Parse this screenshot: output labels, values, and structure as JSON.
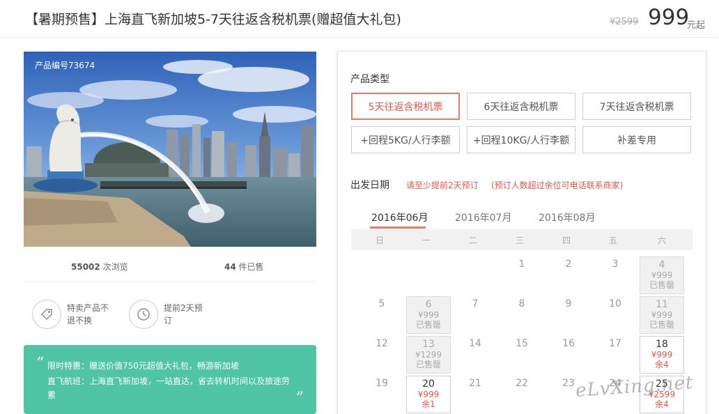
{
  "header": {
    "title": "【暑期预售】上海直飞新加坡5-7天往返含税机票(赠超值大礼包)",
    "original_price": "¥2599",
    "price": "999",
    "price_unit": "元起"
  },
  "photo": {
    "product_code": "产品编号73674"
  },
  "stats": {
    "views_count": "55002",
    "views_label": " 次浏览",
    "sold_count": "44",
    "sold_label": " 件已售"
  },
  "features": [
    {
      "icon": "tag-icon",
      "text": "特卖产品不退不换"
    },
    {
      "icon": "clock-icon",
      "text": "提前2天预订"
    }
  ],
  "promo": {
    "open_quote": "“",
    "close_quote": "”",
    "line1": "限时特惠：赠送价值750元超值大礼包，畅游新加坡",
    "line2": "直飞航班：上海直飞新加坡，一站直达，省去转机时间以及旅途劳",
    "line3": "累"
  },
  "product_type": {
    "label": "产品类型",
    "options": [
      "5天往返含税机票",
      "6天往返含税机票",
      "7天往返含税机票",
      "+回程5KG/人行李额",
      "+回程10KG/人行李额",
      "补差专用"
    ],
    "selected_index": 0
  },
  "departure": {
    "label": "出发日期",
    "note1": "请至少提前2天预订",
    "note2": "(预订人数超过余位可电话联系商家)"
  },
  "calendar": {
    "months": [
      "2016年06月",
      "2016年07月",
      "2016年08月"
    ],
    "active_month_index": 0,
    "weekdays": [
      "日",
      "一",
      "二",
      "三",
      "四",
      "五",
      "六"
    ],
    "plain_days": [
      "1",
      "2",
      "3",
      "5",
      "7",
      "8",
      "9",
      "10",
      "12",
      "14",
      "15",
      "16",
      "17",
      "19",
      "21",
      "22",
      "23",
      "24"
    ],
    "cells": [
      {
        "day": "4",
        "price": "¥999",
        "status": "已售罄",
        "state": "soldout"
      },
      {
        "day": "6",
        "price": "¥999",
        "status": "已售罄",
        "state": "soldout"
      },
      {
        "day": "11",
        "price": "¥999",
        "status": "已售罄",
        "state": "soldout"
      },
      {
        "day": "13",
        "price": "¥1299",
        "status": "已售罄",
        "state": "soldout"
      },
      {
        "day": "18",
        "price": "¥999",
        "status": "余4",
        "state": "available"
      },
      {
        "day": "20",
        "price": "¥999",
        "status": "余1",
        "state": "available"
      },
      {
        "day": "25",
        "price": "¥2599",
        "status": "余4",
        "state": "available"
      }
    ]
  },
  "watermark": "eLvXing.net"
}
